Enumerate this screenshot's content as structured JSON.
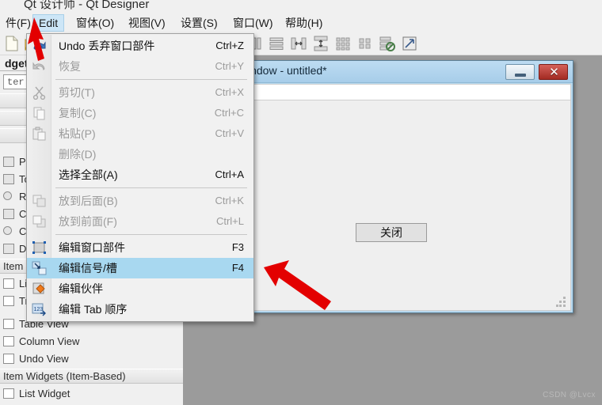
{
  "window": {
    "title": "Qt 设计师 - Qt Designer"
  },
  "menubar": {
    "items": [
      {
        "label": "件(F)",
        "mnemonic": "F",
        "active": false
      },
      {
        "label": "Edit",
        "mnemonic": "E",
        "active": true
      },
      {
        "label": "窗体(O)",
        "mnemonic": "O",
        "active": false
      },
      {
        "label": "视图(V)",
        "mnemonic": "V",
        "active": false
      },
      {
        "label": "设置(S)",
        "mnemonic": "S",
        "active": false
      },
      {
        "label": "窗口(W)",
        "mnemonic": "W",
        "active": false
      },
      {
        "label": "帮助(H)",
        "mnemonic": "H",
        "active": false
      }
    ]
  },
  "toolbar": {
    "icons": [
      "new-file-icon",
      "open-folder-icon",
      "save-icon",
      "layout-horizontal-icon",
      "layout-vertical-icon",
      "layout-splitter-h-icon",
      "layout-splitter-v-icon",
      "layout-grid-icon",
      "layout-form-icon",
      "break-layout-icon",
      "adjust-size-icon"
    ]
  },
  "edit_menu": {
    "name": "Edit",
    "items": [
      {
        "label": "Undo 丢弃窗口部件",
        "shortcut": "Ctrl+Z",
        "disabled": false,
        "selected": false,
        "icon": "undo-icon"
      },
      {
        "label": "恢复",
        "shortcut": "Ctrl+Y",
        "disabled": true,
        "selected": false,
        "icon": "redo-icon"
      },
      {
        "separator": true
      },
      {
        "label": "剪切(T)",
        "shortcut": "Ctrl+X",
        "disabled": true,
        "selected": false,
        "icon": "cut-icon"
      },
      {
        "label": "复制(C)",
        "shortcut": "Ctrl+C",
        "disabled": true,
        "selected": false,
        "icon": "copy-icon"
      },
      {
        "label": "粘贴(P)",
        "shortcut": "Ctrl+V",
        "disabled": true,
        "selected": false,
        "icon": "paste-icon"
      },
      {
        "label": "删除(D)",
        "shortcut": "",
        "disabled": true,
        "selected": false,
        "icon": ""
      },
      {
        "label": "选择全部(A)",
        "shortcut": "Ctrl+A",
        "disabled": false,
        "selected": false,
        "icon": ""
      },
      {
        "separator": true
      },
      {
        "label": "放到后面(B)",
        "shortcut": "Ctrl+K",
        "disabled": true,
        "selected": false,
        "icon": "send-to-back-icon"
      },
      {
        "label": "放到前面(F)",
        "shortcut": "Ctrl+L",
        "disabled": true,
        "selected": false,
        "icon": "bring-to-front-icon"
      },
      {
        "separator": true
      },
      {
        "label": "编辑窗口部件",
        "shortcut": "F3",
        "disabled": false,
        "selected": false,
        "icon": "edit-widgets-icon"
      },
      {
        "label": "编辑信号/槽",
        "shortcut": "F4",
        "disabled": false,
        "selected": true,
        "icon": "edit-signals-slots-icon"
      },
      {
        "label": "编辑伙伴",
        "shortcut": "",
        "disabled": false,
        "selected": false,
        "icon": "edit-buddies-icon"
      },
      {
        "label": "编辑 Tab 顺序",
        "shortcut": "",
        "disabled": false,
        "selected": false,
        "icon": "edit-tab-order-icon"
      }
    ]
  },
  "widget_box": {
    "title": "dget",
    "filter_placeholder": "ter",
    "groups": [
      {
        "type": "item",
        "label": "Push"
      },
      {
        "type": "item",
        "label": "Tool"
      },
      {
        "type": "item",
        "label": "Radi"
      },
      {
        "type": "item",
        "label": "Chec"
      },
      {
        "type": "item",
        "label": "Com"
      },
      {
        "type": "item",
        "label": "Dialo"
      },
      {
        "type": "category",
        "label": "Item"
      },
      {
        "type": "item",
        "label": "List "
      },
      {
        "type": "item",
        "label": "Tree"
      },
      {
        "type": "item",
        "label": "Table View"
      },
      {
        "type": "item",
        "label": "Column View"
      },
      {
        "type": "item",
        "label": "Undo View"
      },
      {
        "type": "category",
        "label": "Item Widgets (Item-Based)"
      },
      {
        "type": "item",
        "label": "List Widget"
      }
    ]
  },
  "form_window": {
    "title": "indow - untitled*",
    "minimize_label": "—",
    "close_label": "✕",
    "button_label": "关闭"
  },
  "watermark": "CSDN @Lvcx",
  "colors": {
    "menu_highlight": "#a8d8f0",
    "menubar_highlight": "#cde6f7",
    "titlebar_gradient_top": "#bddcf2",
    "close_button": "#a32a22",
    "workspace": "#9b9b9b",
    "annotation_arrow": "#e30000"
  }
}
